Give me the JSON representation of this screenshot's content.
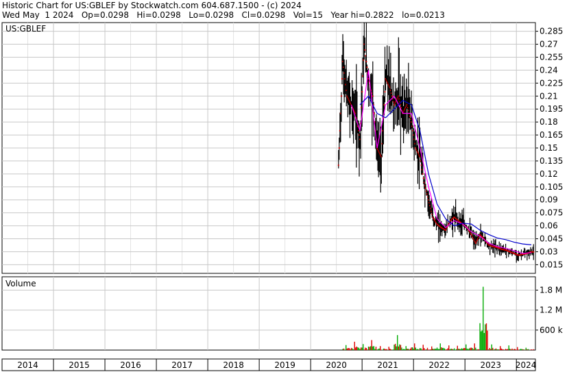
{
  "header": {
    "line1": "Historic Chart for US:GBLEF by Stockwatch.com 604.687.1500 - (c) 2024",
    "line2": "Wed May  1 2024   Op=0.0298   Hi=0.0298   Lo=0.0298   Cl=0.0298   Vol=15   Year hi=0.2822   lo=0.0213"
  },
  "price_panel": {
    "symbol_label": "US:GBLEF",
    "y_ticks": [
      "0.285",
      "0.27",
      "0.255",
      "0.24",
      "0.225",
      "0.21",
      "0.195",
      "0.18",
      "0.165",
      "0.15",
      "0.135",
      "0.12",
      "0.105",
      "0.09",
      "0.075",
      "0.06",
      "0.045",
      "0.03",
      "0.015"
    ]
  },
  "volume_panel": {
    "label": "Volume",
    "y_ticks": [
      "1.8 M",
      "1.2 M",
      "600 k"
    ]
  },
  "x_axis": {
    "years": [
      "2014",
      "2015",
      "2016",
      "2017",
      "2018",
      "2019",
      "2020",
      "2021",
      "2022",
      "2023",
      "2024"
    ]
  },
  "colors": {
    "bars": "#000000",
    "close_dots": "#cc0000",
    "ma_short": "#ff00ff",
    "ma_long": "#0000cc",
    "volume_up": "#00aa00",
    "volume_down": "#dd0000",
    "grid": "#c8c8c8"
  },
  "chart_data": {
    "type": "line",
    "title": "Historic Chart for US:GBLEF",
    "ylim": [
      0.005,
      0.295
    ],
    "volume_ylim": [
      0,
      2200000
    ],
    "series": [
      {
        "name": "price",
        "x": [
          "2020-07",
          "2020-08",
          "2020-09",
          "2020-10",
          "2020-11",
          "2020-12",
          "2021-01",
          "2021-02",
          "2021-03",
          "2021-04",
          "2021-05",
          "2021-06",
          "2021-07",
          "2021-08",
          "2021-09",
          "2021-10",
          "2021-11",
          "2021-12",
          "2022-01",
          "2022-02",
          "2022-03",
          "2022-04",
          "2022-05",
          "2022-06",
          "2022-07",
          "2022-08",
          "2022-09",
          "2022-10",
          "2022-11",
          "2022-12",
          "2023-01",
          "2023-02",
          "2023-03",
          "2023-04",
          "2023-05",
          "2023-06",
          "2023-07",
          "2023-08",
          "2023-09",
          "2023-10",
          "2023-11",
          "2023-12",
          "2024-01",
          "2024-02",
          "2024-03",
          "2024-04"
        ],
        "values": [
          0.13,
          0.25,
          0.21,
          0.2,
          0.19,
          0.16,
          0.27,
          0.23,
          0.21,
          0.15,
          0.14,
          0.23,
          0.22,
          0.2,
          0.21,
          0.19,
          0.2,
          0.18,
          0.15,
          0.14,
          0.11,
          0.09,
          0.07,
          0.062,
          0.058,
          0.055,
          0.065,
          0.07,
          0.066,
          0.062,
          0.058,
          0.05,
          0.04,
          0.05,
          0.045,
          0.038,
          0.036,
          0.035,
          0.033,
          0.032,
          0.03,
          0.028,
          0.026,
          0.027,
          0.028,
          0.0298
        ]
      },
      {
        "name": "ma_short",
        "x": [
          "2020-10",
          "2020-12",
          "2021-02",
          "2021-04",
          "2021-06",
          "2021-08",
          "2021-10",
          "2021-12",
          "2022-02",
          "2022-04",
          "2022-06",
          "2022-08",
          "2022-10",
          "2022-12",
          "2023-02",
          "2023-04",
          "2023-06",
          "2023-08",
          "2023-10",
          "2023-12",
          "2024-02",
          "2024-04"
        ],
        "values": [
          0.2,
          0.17,
          0.24,
          0.15,
          0.2,
          0.21,
          0.19,
          0.19,
          0.15,
          0.105,
          0.068,
          0.058,
          0.066,
          0.062,
          0.053,
          0.048,
          0.04,
          0.036,
          0.034,
          0.031,
          0.028,
          0.029
        ]
      },
      {
        "name": "ma_long",
        "x": [
          "2020-12",
          "2021-02",
          "2021-04",
          "2021-06",
          "2021-08",
          "2021-10",
          "2021-12",
          "2022-02",
          "2022-04",
          "2022-06",
          "2022-08",
          "2022-10",
          "2022-12",
          "2023-02",
          "2023-04",
          "2023-06",
          "2023-08",
          "2023-10",
          "2023-12",
          "2024-02",
          "2024-04"
        ],
        "values": [
          0.2,
          0.21,
          0.19,
          0.185,
          0.195,
          0.205,
          0.2,
          0.17,
          0.12,
          0.085,
          0.068,
          0.06,
          0.063,
          0.062,
          0.055,
          0.05,
          0.046,
          0.044,
          0.041,
          0.039,
          0.038
        ]
      }
    ],
    "volume": {
      "x": [
        "2020-08",
        "2020-10",
        "2020-12",
        "2021-02",
        "2021-04",
        "2021-06",
        "2021-08",
        "2021-10",
        "2021-12",
        "2022-02",
        "2022-04",
        "2022-06",
        "2022-08",
        "2022-10",
        "2022-12",
        "2023-02",
        "2023-04",
        "2023-06",
        "2023-08",
        "2023-10",
        "2023-12",
        "2024-02",
        "2024-04"
      ],
      "values": [
        150000,
        250000,
        180000,
        300000,
        120000,
        100000,
        450000,
        120000,
        200000,
        160000,
        110000,
        200000,
        140000,
        130000,
        170000,
        200000,
        1900000,
        170000,
        120000,
        140000,
        90000,
        70000,
        60000
      ]
    }
  }
}
